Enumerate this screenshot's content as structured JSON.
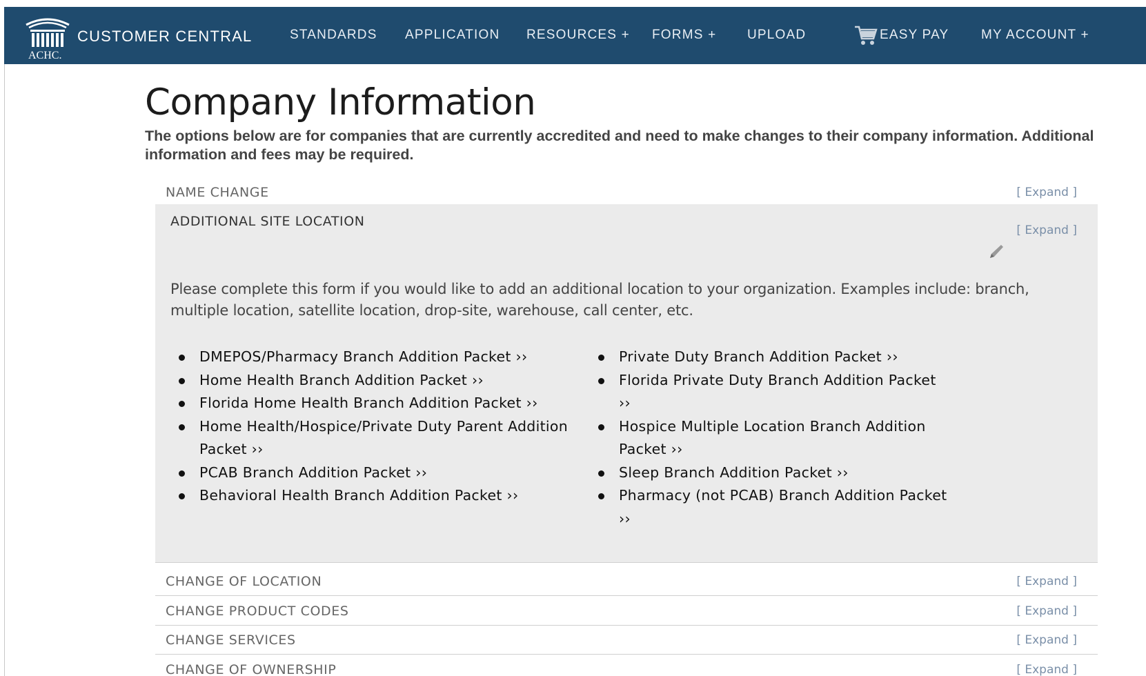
{
  "nav": {
    "logo_text": "ACHC.",
    "brand": "CUSTOMER CENTRAL",
    "items": [
      {
        "label": "STANDARDS"
      },
      {
        "label": "APPLICATION"
      },
      {
        "label": "RESOURCES +"
      },
      {
        "label": "FORMS +"
      },
      {
        "label": "UPLOAD"
      },
      {
        "label": "EASY PAY",
        "icon": "cart-icon"
      },
      {
        "label": "MY ACCOUNT +"
      }
    ]
  },
  "page": {
    "title": "Company Information",
    "intro": "The options below are for companies that are currently accredited and need to make changes to their company information. Additional information and fees may be required."
  },
  "accordion": {
    "expand_label": "[ Expand ]",
    "name_change": "NAME CHANGE",
    "additional_site": {
      "title": "ADDITIONAL SITE LOCATION",
      "description": "Please complete this form if you would like to add an additional location to your organization. Examples include: branch, multiple location, satellite location, drop-site, warehouse, call center, etc.",
      "left_packets": [
        "DMEPOS/Pharmacy Branch Addition Packet ››",
        "Home Health Branch Addition Packet ››",
        "Florida Home Health Branch Addition Packet ››",
        "Home Health/Hospice/Private Duty Parent Addition Packet ››",
        "PCAB Branch Addition Packet ››",
        "Behavioral Health Branch Addition Packet ››"
      ],
      "right_packets": [
        "Private Duty Branch Addition Packet ››",
        "Florida Private Duty Branch Addition Packet ››",
        "Hospice Multiple Location Branch Addition Packet ››",
        "Sleep Branch Addition Packet ››",
        "Pharmacy (not PCAB) Branch Addition Packet ››"
      ]
    },
    "change_location": "CHANGE OF LOCATION",
    "change_product_codes": "CHANGE PRODUCT CODES",
    "change_services": "CHANGE SERVICES",
    "change_ownership": "CHANGE OF OWNERSHIP"
  },
  "colors": {
    "nav_bg": "#1f4b6e",
    "panel_bg": "#ebebeb",
    "expand_link": "#7a8fa8"
  }
}
